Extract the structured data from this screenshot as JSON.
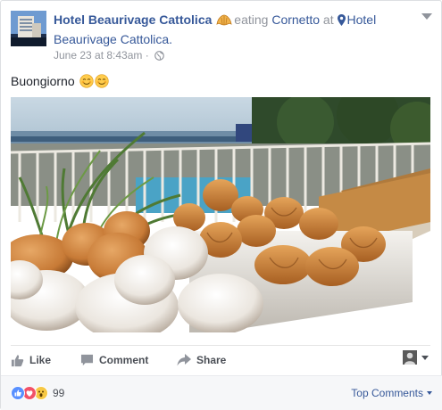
{
  "post": {
    "page_name": "Hotel Beaurivage Cattolica",
    "activity_verb": "eating",
    "activity_object": "Cornetto",
    "at_word": "at",
    "place_name": "Hotel Beaurivage Cattolica.",
    "timestamp": "June 23 at 8:43am",
    "separator": "·",
    "text": "Buongiorno",
    "privacy_icon": "globe-icon",
    "feeling_icon": "croissant-icon",
    "place_icon": "map-pin-icon"
  },
  "actions": {
    "like_label": "Like",
    "comment_label": "Comment",
    "share_label": "Share"
  },
  "footer": {
    "reaction_icons": [
      "like-reaction-icon",
      "love-reaction-icon",
      "wow-reaction-icon"
    ],
    "reaction_count": "99",
    "top_comments_label": "Top Comments"
  },
  "colors": {
    "link_blue": "#365899",
    "like_blue": "#5890ff",
    "love_red": "#f25268",
    "wow_yellow": "#f7c844",
    "meta_gray": "#90949c",
    "action_gray": "#4b4f56"
  }
}
